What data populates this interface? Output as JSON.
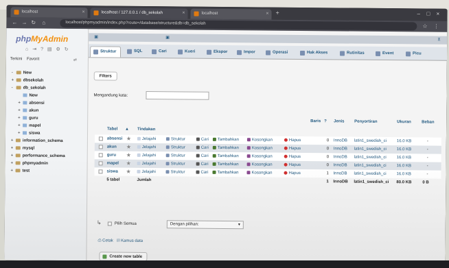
{
  "browser": {
    "tabs": [
      {
        "label": "localhost"
      },
      {
        "label": "localhost / 127.0.0.1 / db_sekolah"
      },
      {
        "label": "localhost"
      }
    ],
    "url": "localhost/phpmyadmin/index.php?route=/database/structure&db=db_sekolah"
  },
  "sidebar": {
    "logo_php": "php",
    "logo_rest": "MyAdmin",
    "tab_recent": "Terkini",
    "tab_fav": "Favorit",
    "tree": [
      {
        "label": "New",
        "kind": "new"
      },
      {
        "label": "dbsekolah",
        "kind": "db"
      },
      {
        "label": "db_sekolah",
        "kind": "db"
      },
      {
        "label": "New",
        "kind": "table"
      },
      {
        "label": "absensi",
        "kind": "table"
      },
      {
        "label": "akun",
        "kind": "table"
      },
      {
        "label": "guru",
        "kind": "table"
      },
      {
        "label": "mapel",
        "kind": "table"
      },
      {
        "label": "siswa",
        "kind": "table"
      },
      {
        "label": "information_schema",
        "kind": "db"
      },
      {
        "label": "mysql",
        "kind": "db"
      },
      {
        "label": "performance_schema",
        "kind": "db"
      },
      {
        "label": "phpmyadmin",
        "kind": "db"
      },
      {
        "label": "test",
        "kind": "db"
      }
    ]
  },
  "main_tabs": [
    {
      "label": "Struktur"
    },
    {
      "label": "SQL"
    },
    {
      "label": "Cari"
    },
    {
      "label": "Kueri"
    },
    {
      "label": "Ekspor"
    },
    {
      "label": "Impor"
    },
    {
      "label": "Operasi"
    },
    {
      "label": "Hak Akses"
    },
    {
      "label": "Rutinitas"
    },
    {
      "label": "Event"
    },
    {
      "label": "Picu"
    }
  ],
  "filters": {
    "button": "Filters",
    "label": "Mengandung kata:"
  },
  "table": {
    "headers": {
      "table": "Tabel",
      "action": "Tindakan",
      "rows": "Baris",
      "type": "Jenis",
      "collation": "Penyortiran",
      "size": "Ukuran",
      "overhead": "Beban"
    },
    "actions": [
      "Jelajahi",
      "Struktur",
      "Cari",
      "Tambahkan",
      "Kosongkan",
      "Hapus"
    ],
    "rows": [
      {
        "name": "absensi",
        "rows": "0",
        "type": "InnoDB",
        "collation": "latin1_swedish_ci",
        "size": "16.0 KB",
        "overhead": "-"
      },
      {
        "name": "akun",
        "rows": "0",
        "type": "InnoDB",
        "collation": "latin1_swedish_ci",
        "size": "16.0 KB",
        "overhead": "-"
      },
      {
        "name": "guru",
        "rows": "0",
        "type": "InnoDB",
        "collation": "latin1_swedish_ci",
        "size": "16.0 KB",
        "overhead": "-"
      },
      {
        "name": "mapel",
        "rows": "0",
        "type": "InnoDB",
        "collation": "latin1_swedish_ci",
        "size": "16.0 KB",
        "overhead": "-"
      },
      {
        "name": "siswa",
        "rows": "1",
        "type": "InnoDB",
        "collation": "latin1_swedish_ci",
        "size": "16.0 KB",
        "overhead": "-"
      }
    ],
    "summary": {
      "tables": "5 tabel",
      "label": "Jumlah",
      "rows": "1",
      "type": "InnoDB",
      "collation": "latin1_swedish_ci",
      "size": "80.0 KB",
      "overhead": "0 B"
    }
  },
  "bulk": {
    "check_all": "Pilih Semua",
    "select": "Dengan pilihan:"
  },
  "links": {
    "print": "Cetak",
    "dictionary": "Kamus data"
  },
  "create": {
    "button": "Create new table"
  }
}
